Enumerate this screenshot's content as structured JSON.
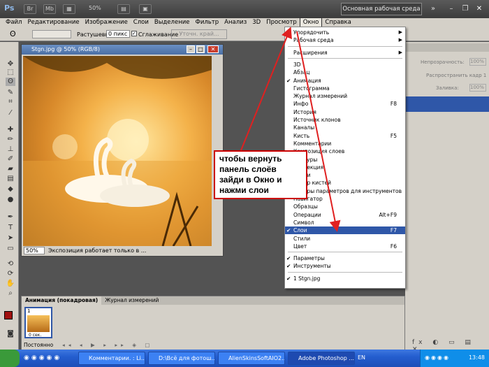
{
  "app": {
    "logo": "Ps",
    "zoom": "50%",
    "workspace_button": "Основная рабочая среда"
  },
  "menubar": [
    "Файл",
    "Редактирование",
    "Изображение",
    "Слои",
    "Выделение",
    "Фильтр",
    "Анализ",
    "3D",
    "Просмотр",
    "Окно",
    "Справка"
  ],
  "options": {
    "feather_label": "Растушевка:",
    "feather_value": "0 пикс",
    "smooth_label": "Сглаживание",
    "refine_button": "Уточн. край..."
  },
  "document": {
    "title": "Stgn.jpg @ 50% (RGB/8)",
    "zoom": "50%",
    "status": "Экспозиция работает только в ..."
  },
  "right_panel": {
    "opacity_label": "Непрозрачность:",
    "opacity_value": "100%",
    "propagate_label": "Распространить кадр 1",
    "fill_label": "Заливка:",
    "fill_value": "100%"
  },
  "menu": {
    "items": [
      {
        "label": "Упорядочить",
        "submenu": true
      },
      {
        "label": "Рабочая среда",
        "submenu": true
      },
      {
        "label": "Расширения",
        "submenu": true
      },
      {
        "label": "3D"
      },
      {
        "label": "Абзац"
      },
      {
        "label": "Анимация",
        "checked": true
      },
      {
        "label": "Гистограмма"
      },
      {
        "label": "Журнал измерений"
      },
      {
        "label": "Инфо",
        "shortcut": "F8"
      },
      {
        "label": "История"
      },
      {
        "label": "Источник клонов"
      },
      {
        "label": "Каналы"
      },
      {
        "label": "Кисть",
        "shortcut": "F5"
      },
      {
        "label": "Комментарии"
      },
      {
        "label": "Композиция слоев"
      },
      {
        "label": "Контуры"
      },
      {
        "label": "Коррекция"
      },
      {
        "label": "Маски"
      },
      {
        "label": "Набор кистей"
      },
      {
        "label": "Наборы параметров для инструментов"
      },
      {
        "label": "Навигатор"
      },
      {
        "label": "Образцы"
      },
      {
        "label": "Операции",
        "shortcut": "Alt+F9"
      },
      {
        "label": "Символ"
      },
      {
        "label": "Слои",
        "shortcut": "F7",
        "checked": true,
        "highlighted": true
      },
      {
        "label": "Стили"
      },
      {
        "label": "Цвет",
        "shortcut": "F6"
      },
      {
        "label": "Параметры",
        "checked": true
      },
      {
        "label": "Инструменты",
        "checked": true
      },
      {
        "label": "1 Stgn.jpg",
        "checked": true
      }
    ]
  },
  "callout": "чтобы вернуть панель слоёв зайди в Окно и нажми слои",
  "animation": {
    "tabs": [
      "Анимация (покадровая)",
      "Журнал измерений"
    ],
    "frame_number": "1",
    "frame_delay": "0 сек.",
    "loop": "Постоянно"
  },
  "taskbar": {
    "tasks": [
      "Комментарии. : Li...",
      "D:\\Всё для фотош...",
      "AlienSkinsSoftAIO2...",
      "Adobe Photoshop ..."
    ],
    "lang": "EN",
    "clock": "13:48"
  },
  "colors": {
    "highlight": "#2f57a8",
    "callout_border": "#cc0000"
  }
}
